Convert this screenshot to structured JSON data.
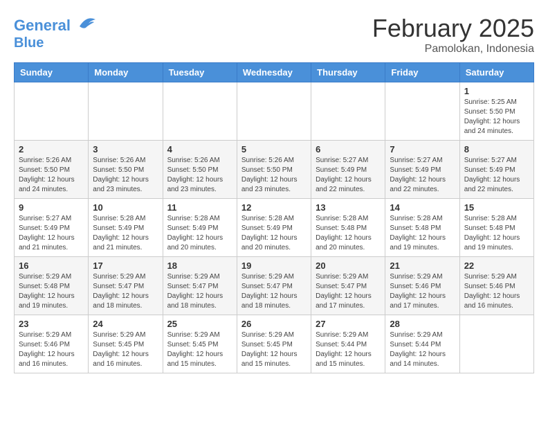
{
  "header": {
    "logo_line1": "General",
    "logo_line2": "Blue",
    "month_title": "February 2025",
    "location": "Pamolokan, Indonesia"
  },
  "weekdays": [
    "Sunday",
    "Monday",
    "Tuesday",
    "Wednesday",
    "Thursday",
    "Friday",
    "Saturday"
  ],
  "weeks": [
    [
      {
        "day": "",
        "info": ""
      },
      {
        "day": "",
        "info": ""
      },
      {
        "day": "",
        "info": ""
      },
      {
        "day": "",
        "info": ""
      },
      {
        "day": "",
        "info": ""
      },
      {
        "day": "",
        "info": ""
      },
      {
        "day": "1",
        "info": "Sunrise: 5:25 AM\nSunset: 5:50 PM\nDaylight: 12 hours\nand 24 minutes."
      }
    ],
    [
      {
        "day": "2",
        "info": "Sunrise: 5:26 AM\nSunset: 5:50 PM\nDaylight: 12 hours\nand 24 minutes."
      },
      {
        "day": "3",
        "info": "Sunrise: 5:26 AM\nSunset: 5:50 PM\nDaylight: 12 hours\nand 23 minutes."
      },
      {
        "day": "4",
        "info": "Sunrise: 5:26 AM\nSunset: 5:50 PM\nDaylight: 12 hours\nand 23 minutes."
      },
      {
        "day": "5",
        "info": "Sunrise: 5:26 AM\nSunset: 5:50 PM\nDaylight: 12 hours\nand 23 minutes."
      },
      {
        "day": "6",
        "info": "Sunrise: 5:27 AM\nSunset: 5:49 PM\nDaylight: 12 hours\nand 22 minutes."
      },
      {
        "day": "7",
        "info": "Sunrise: 5:27 AM\nSunset: 5:49 PM\nDaylight: 12 hours\nand 22 minutes."
      },
      {
        "day": "8",
        "info": "Sunrise: 5:27 AM\nSunset: 5:49 PM\nDaylight: 12 hours\nand 22 minutes."
      }
    ],
    [
      {
        "day": "9",
        "info": "Sunrise: 5:27 AM\nSunset: 5:49 PM\nDaylight: 12 hours\nand 21 minutes."
      },
      {
        "day": "10",
        "info": "Sunrise: 5:28 AM\nSunset: 5:49 PM\nDaylight: 12 hours\nand 21 minutes."
      },
      {
        "day": "11",
        "info": "Sunrise: 5:28 AM\nSunset: 5:49 PM\nDaylight: 12 hours\nand 20 minutes."
      },
      {
        "day": "12",
        "info": "Sunrise: 5:28 AM\nSunset: 5:49 PM\nDaylight: 12 hours\nand 20 minutes."
      },
      {
        "day": "13",
        "info": "Sunrise: 5:28 AM\nSunset: 5:48 PM\nDaylight: 12 hours\nand 20 minutes."
      },
      {
        "day": "14",
        "info": "Sunrise: 5:28 AM\nSunset: 5:48 PM\nDaylight: 12 hours\nand 19 minutes."
      },
      {
        "day": "15",
        "info": "Sunrise: 5:28 AM\nSunset: 5:48 PM\nDaylight: 12 hours\nand 19 minutes."
      }
    ],
    [
      {
        "day": "16",
        "info": "Sunrise: 5:29 AM\nSunset: 5:48 PM\nDaylight: 12 hours\nand 19 minutes."
      },
      {
        "day": "17",
        "info": "Sunrise: 5:29 AM\nSunset: 5:47 PM\nDaylight: 12 hours\nand 18 minutes."
      },
      {
        "day": "18",
        "info": "Sunrise: 5:29 AM\nSunset: 5:47 PM\nDaylight: 12 hours\nand 18 minutes."
      },
      {
        "day": "19",
        "info": "Sunrise: 5:29 AM\nSunset: 5:47 PM\nDaylight: 12 hours\nand 18 minutes."
      },
      {
        "day": "20",
        "info": "Sunrise: 5:29 AM\nSunset: 5:47 PM\nDaylight: 12 hours\nand 17 minutes."
      },
      {
        "day": "21",
        "info": "Sunrise: 5:29 AM\nSunset: 5:46 PM\nDaylight: 12 hours\nand 17 minutes."
      },
      {
        "day": "22",
        "info": "Sunrise: 5:29 AM\nSunset: 5:46 PM\nDaylight: 12 hours\nand 16 minutes."
      }
    ],
    [
      {
        "day": "23",
        "info": "Sunrise: 5:29 AM\nSunset: 5:46 PM\nDaylight: 12 hours\nand 16 minutes."
      },
      {
        "day": "24",
        "info": "Sunrise: 5:29 AM\nSunset: 5:45 PM\nDaylight: 12 hours\nand 16 minutes."
      },
      {
        "day": "25",
        "info": "Sunrise: 5:29 AM\nSunset: 5:45 PM\nDaylight: 12 hours\nand 15 minutes."
      },
      {
        "day": "26",
        "info": "Sunrise: 5:29 AM\nSunset: 5:45 PM\nDaylight: 12 hours\nand 15 minutes."
      },
      {
        "day": "27",
        "info": "Sunrise: 5:29 AM\nSunset: 5:44 PM\nDaylight: 12 hours\nand 15 minutes."
      },
      {
        "day": "28",
        "info": "Sunrise: 5:29 AM\nSunset: 5:44 PM\nDaylight: 12 hours\nand 14 minutes."
      },
      {
        "day": "",
        "info": ""
      }
    ]
  ]
}
